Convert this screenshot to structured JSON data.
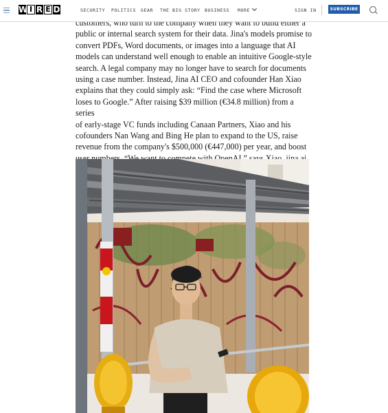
{
  "nav": {
    "logo_letters": [
      "W",
      "I",
      "R",
      "E",
      "D"
    ],
    "links": [
      "SECURITY",
      "POLITICS",
      "GEAR",
      "THE BIG STORY",
      "BUSINESS"
    ],
    "more_label": "MORE",
    "sign_in": "SIGN IN",
    "subscribe": "SUBSCRIBE",
    "accent_color": "#1f5cad"
  },
  "article": {
    "line_0": "customers, who turn to the company when they want to build either a",
    "line_1": "public or internal search system for their data. Jina's models promise to",
    "line_2": "convert PDFs, Word documents, or images into a language that AI",
    "line_3": "models can understand well enough to enable an intuitive Google-style",
    "line_4": "search. A legal company may no longer have to search for documents",
    "line_5": "using a case number. Instead, Jina AI CEO and cofounder Han Xiao",
    "line_6": "explains that they could simply ask: “Find the case where Microsoft",
    "line_7": "loses to Google.” After raising $39 million (€34.8 million) from a series",
    "line_8": "of early-stage VC funds including Canaan Partners, Xiao and his",
    "line_9": "cofounders Nan Wang and Bing He plan to expand to the US, raise",
    "line_10": "revenue from the company's $500,000 (€447,000) per year, and boost",
    "line_11": "user numbers. “We want to compete with OpenAI,” says Xiao.",
    "link_text": "jina.ai"
  }
}
